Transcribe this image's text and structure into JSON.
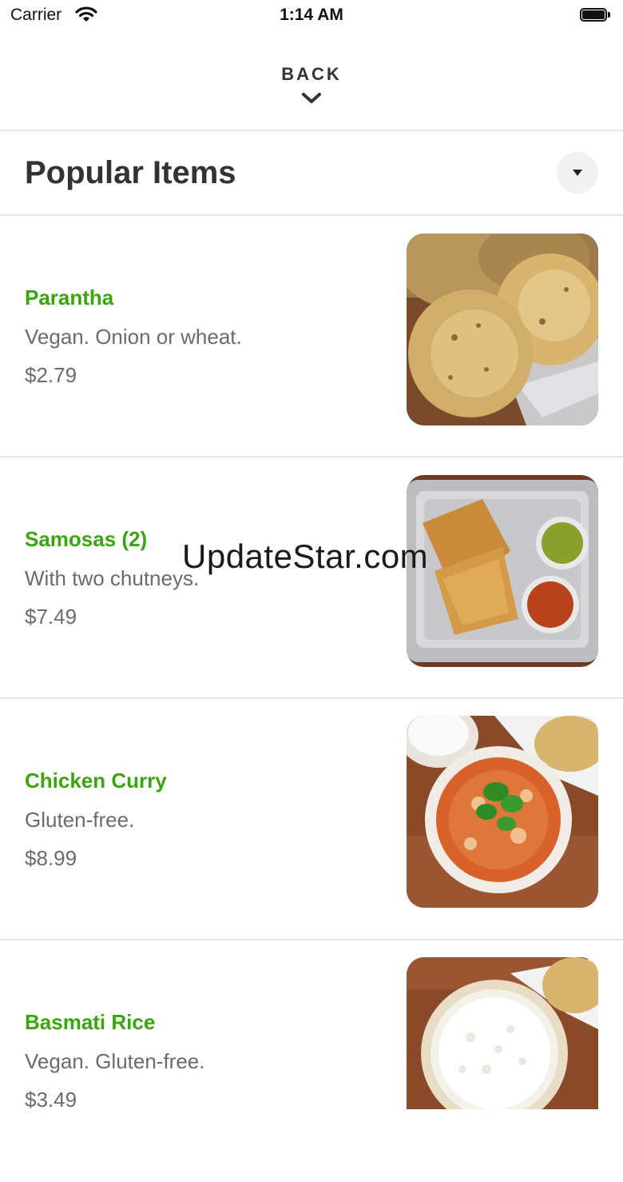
{
  "status_bar": {
    "carrier": "Carrier",
    "time": "1:14 AM"
  },
  "back": {
    "label": "BACK"
  },
  "section": {
    "title": "Popular Items"
  },
  "items": [
    {
      "name": "Parantha",
      "description": "Vegan. Onion or wheat.",
      "price": "$2.79"
    },
    {
      "name": "Samosas (2)",
      "description": "With two chutneys.",
      "price": "$7.49"
    },
    {
      "name": "Chicken Curry",
      "description": "Gluten-free.",
      "price": "$8.99"
    },
    {
      "name": "Basmati Rice",
      "description": "Vegan. Gluten-free.",
      "price": "$3.49"
    }
  ],
  "watermark": "UpdateStar.com",
  "colors": {
    "accent": "#3aa60e",
    "text": "#333333",
    "muted": "#6b6b6b",
    "divider": "#e6e6e6"
  }
}
